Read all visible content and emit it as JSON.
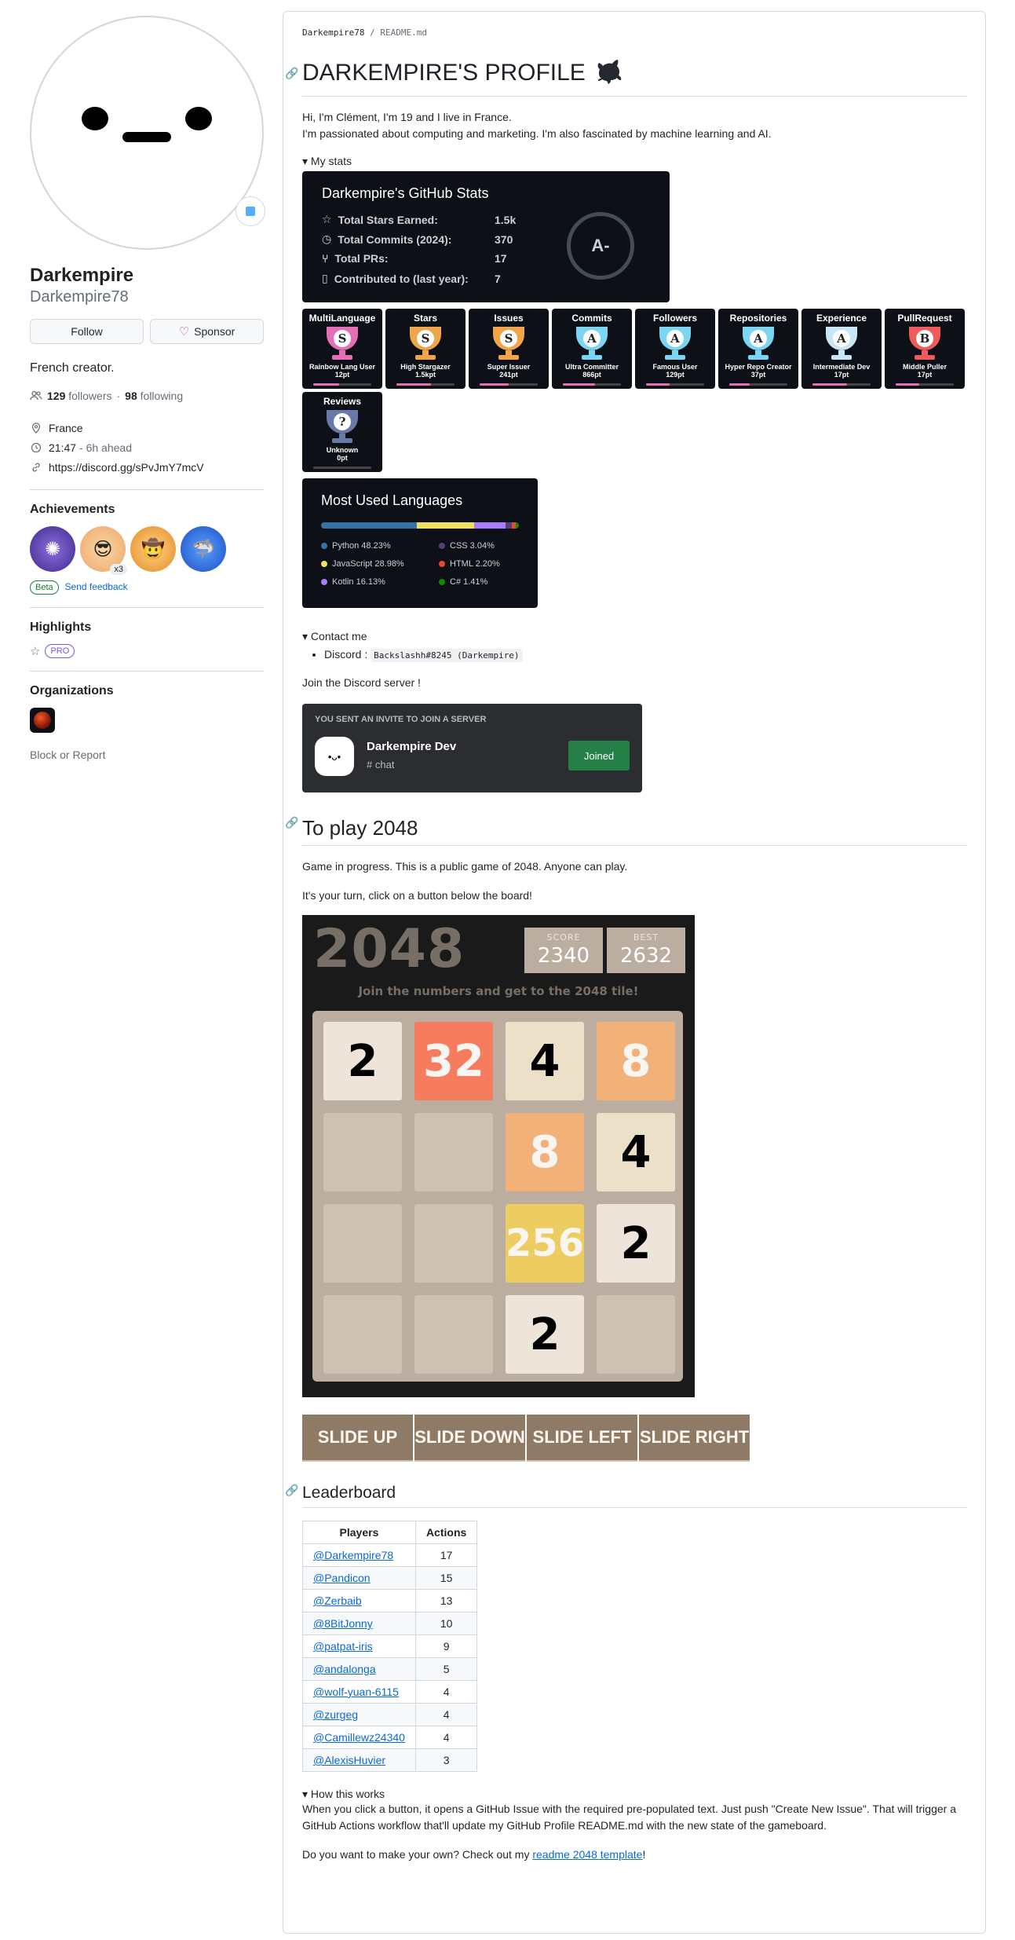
{
  "sidebar": {
    "name": "Darkempire",
    "login": "Darkempire78",
    "follow_label": "Follow",
    "sponsor_label": "Sponsor",
    "bio": "French creator.",
    "followers_count": "129",
    "followers_label": "followers",
    "following_count": "98",
    "following_label": "following",
    "location": "France",
    "time": "21:47",
    "time_note": "- 6h ahead",
    "link": "https://discord.gg/sPvJmY7mcV",
    "achievements_title": "Achievements",
    "achievement_multiplier": "x3",
    "beta_label": "Beta",
    "feedback_label": "Send feedback",
    "highlights_title": "Highlights",
    "pro_label": "PRO",
    "organizations_title": "Organizations",
    "block_label": "Block or Report"
  },
  "readme": {
    "breadcrumb_user": "Darkempire78",
    "breadcrumb_sep": " / ",
    "breadcrumb_file": "README.md",
    "title": "DARKEMPIRE'S PROFILE",
    "intro_1": "Hi, I'm Clément, I'm 19 and I live in France.",
    "intro_2": "I'm passionated about computing and marketing. I'm also fascinated by machine learning and AI.",
    "stats_summary": "My stats",
    "stats_card": {
      "title": "Darkempire's GitHub Stats",
      "rows": [
        {
          "label": "Total Stars Earned:",
          "value": "1.5k"
        },
        {
          "label": "Total Commits (2024):",
          "value": "370"
        },
        {
          "label": "Total PRs:",
          "value": "17"
        },
        {
          "label": "Contributed to (last year):",
          "value": "7"
        }
      ],
      "grade": "A-"
    },
    "trophies": [
      {
        "title": "MultiLanguage",
        "rank": "S",
        "name": "Rainbow Lang User",
        "pt": "12pt",
        "color": "#e46fb5",
        "progress": 0.45
      },
      {
        "title": "Stars",
        "rank": "S",
        "name": "High Stargazer",
        "pt": "1.5kpt",
        "color": "#f0a54a",
        "progress": 0.6
      },
      {
        "title": "Issues",
        "rank": "S",
        "name": "Super Issuer",
        "pt": "241pt",
        "color": "#f0a54a",
        "progress": 0.5
      },
      {
        "title": "Commits",
        "rank": "A",
        "name": "Ultra Committer",
        "pt": "866pt",
        "color": "#7bd6f3",
        "progress": 0.55
      },
      {
        "title": "Followers",
        "rank": "A",
        "name": "Famous User",
        "pt": "129pt",
        "color": "#7bd6f3",
        "progress": 0.4
      },
      {
        "title": "Repositories",
        "rank": "A",
        "name": "Hyper Repo Creator",
        "pt": "37pt",
        "color": "#7bd6f3",
        "progress": 0.35
      },
      {
        "title": "Experience",
        "rank": "A",
        "name": "Intermediate Dev",
        "pt": "17pt",
        "color": "#c8e6f5",
        "progress": 0.6
      },
      {
        "title": "PullRequest",
        "rank": "B",
        "name": "Middle Puller",
        "pt": "17pt",
        "color": "#f05a5a",
        "progress": 0.4
      },
      {
        "title": "Reviews",
        "rank": "?",
        "name": "Unknown",
        "pt": "0pt",
        "color": "#6a7aa8",
        "progress": 0.0
      }
    ],
    "languages_card": {
      "title": "Most Used Languages",
      "langs": [
        {
          "name": "Python 48.23%",
          "pct": 48.23,
          "color": "#3572A5"
        },
        {
          "name": "CSS 3.04%",
          "pct": 3.04,
          "color": "#563d7c"
        },
        {
          "name": "JavaScript 28.98%",
          "pct": 28.98,
          "color": "#f1e05a"
        },
        {
          "name": "HTML 2.20%",
          "pct": 2.2,
          "color": "#e34c26"
        },
        {
          "name": "Kotlin 16.13%",
          "pct": 16.13,
          "color": "#A97BFF"
        },
        {
          "name": "C# 1.41%",
          "pct": 1.41,
          "color": "#178600"
        }
      ]
    },
    "contact_summary": "Contact me",
    "contact_label": "Discord : ",
    "contact_value": "Backslashh#8245 (Darkempire)",
    "join_text": "Join the Discord server !",
    "discord_invite": {
      "header": "YOU SENT AN INVITE TO JOIN A SERVER",
      "server": "Darkempire Dev",
      "channel": "chat",
      "button": "Joined"
    },
    "play_title": "To play 2048",
    "play_p1": "Game in progress. This is a public game of 2048. Anyone can play.",
    "play_p2": "It's your turn, click on a button below the board!",
    "game": {
      "title": "2048",
      "score_label": "SCORE",
      "score": "2340",
      "best_label": "BEST",
      "best": "2632",
      "subtitle_pre": "Join the numbers and get to the ",
      "subtitle_bold": "2048 tile!",
      "board": [
        [
          "2",
          "32",
          "4",
          "8"
        ],
        [
          "",
          "",
          "8",
          "4"
        ],
        [
          "",
          "",
          "256",
          "2"
        ],
        [
          "",
          "",
          "2",
          ""
        ]
      ]
    },
    "moves": [
      "SLIDE UP",
      "SLIDE DOWN",
      "SLIDE LEFT",
      "SLIDE RIGHT"
    ],
    "leaderboard_title": "Leaderboard",
    "leaderboard_headers": [
      "Players",
      "Actions"
    ],
    "leaderboard": [
      {
        "player": "@Darkempire78",
        "actions": "17"
      },
      {
        "player": "@Pandicon",
        "actions": "15"
      },
      {
        "player": "@Zerbaib",
        "actions": "13"
      },
      {
        "player": "@8BitJonny",
        "actions": "10"
      },
      {
        "player": "@patpat-iris",
        "actions": "9"
      },
      {
        "player": "@andalonga",
        "actions": "5"
      },
      {
        "player": "@wolf-yuan-6115",
        "actions": "4"
      },
      {
        "player": "@zurgeg",
        "actions": "4"
      },
      {
        "player": "@Camillewz24340",
        "actions": "4"
      },
      {
        "player": "@AlexisHuvier",
        "actions": "3"
      }
    ],
    "how_summary": "How this works",
    "how_text": "When you click a button, it opens a GitHub Issue with the required pre-populated text. Just push \"Create New Issue\". That will trigger a GitHub Actions workflow that'll update my GitHub Profile README.md with the new state of the gameboard.",
    "own_pre": "Do you want to make your own? Check out my ",
    "own_link": "readme 2048 template",
    "own_post": "!"
  },
  "icons": {
    "people": "people-icon",
    "location": "location-icon",
    "clock": "clock-icon",
    "link": "link-icon",
    "heart": "heart-icon",
    "star": "star-icon",
    "anchor": "anchor-link-icon",
    "hash": "hash-icon"
  },
  "colors": {
    "link": "#0969da",
    "tile_bg": "#cdc1b4",
    "board_bg": "#bbada0",
    "move_btn": "#8f7a66"
  }
}
